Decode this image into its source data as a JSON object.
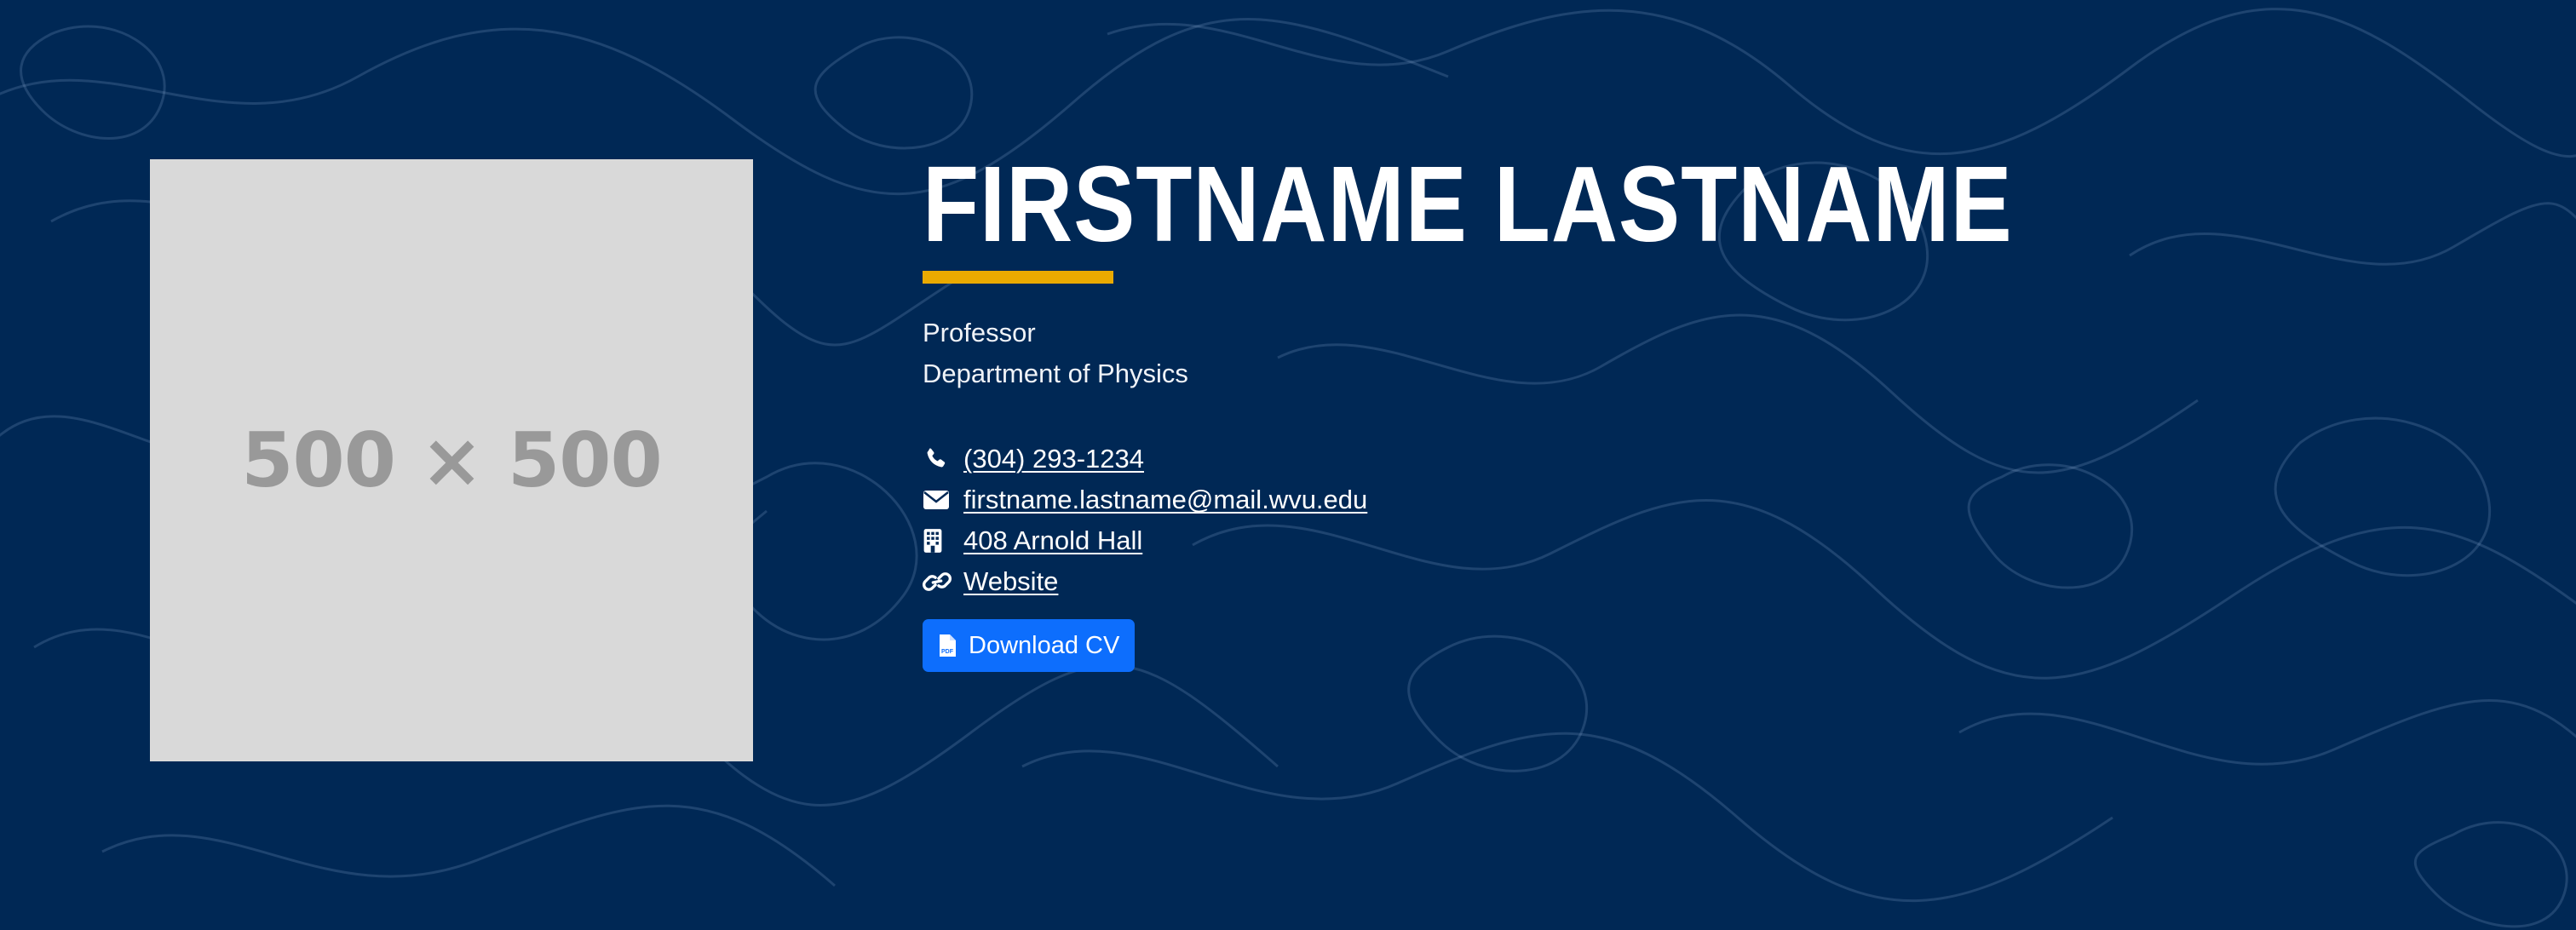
{
  "profile": {
    "photo_placeholder": "500 × 500",
    "name": "FIRSTNAME LASTNAME",
    "position": "Professor",
    "department": "Department of Physics"
  },
  "contacts": {
    "phone": "(304) 293-1234",
    "email": "firstname.lastname@mail.wvu.edu",
    "office": "408 Arnold Hall",
    "website": "Website"
  },
  "actions": {
    "download_cv_label": "Download CV"
  },
  "icons": {
    "phone": "phone-icon",
    "email": "envelope-icon",
    "office": "building-icon",
    "website": "link-icon",
    "cv": "pdf-file-icon"
  },
  "colors": {
    "background": "#002855",
    "accent_underline": "#eaaa00",
    "button": "#0d6efd",
    "placeholder_bg": "#d9d9d9",
    "placeholder_text": "#999999"
  }
}
